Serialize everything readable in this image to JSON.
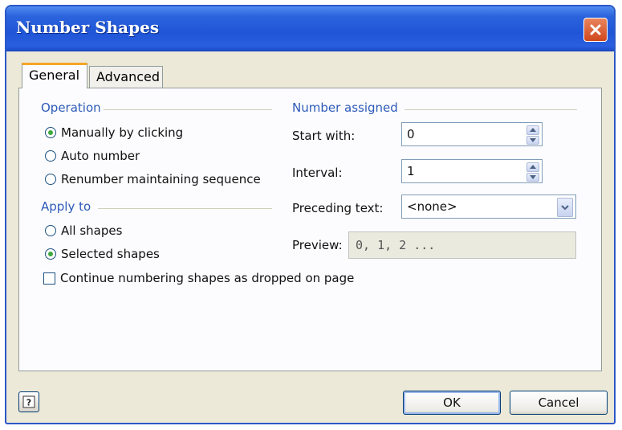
{
  "window": {
    "title": "Number Shapes",
    "accent_color": "#2b58c8",
    "close_icon": "close-icon"
  },
  "tabs": [
    {
      "label": "General",
      "selected": true
    },
    {
      "label": "Advanced",
      "selected": false
    }
  ],
  "operation": {
    "label": "Operation",
    "options": [
      {
        "label": "Manually by clicking",
        "selected": true
      },
      {
        "label": "Auto number",
        "selected": false
      },
      {
        "label": "Renumber maintaining sequence",
        "selected": false
      }
    ]
  },
  "apply_to": {
    "label": "Apply to",
    "options": [
      {
        "label": "All shapes",
        "selected": false
      },
      {
        "label": "Selected shapes",
        "selected": true
      }
    ]
  },
  "continue_numbering": {
    "label": "Continue numbering shapes as dropped on page",
    "checked": false
  },
  "number_assigned": {
    "label": "Number assigned",
    "start_with": {
      "label": "Start with:",
      "value": "0"
    },
    "interval": {
      "label": "Interval:",
      "value": "1"
    },
    "preceding_text": {
      "label": "Preceding text:",
      "value": "<none>"
    },
    "preview": {
      "label": "Preview:",
      "value": "0, 1, 2 ..."
    }
  },
  "footer": {
    "help_icon": "help-icon",
    "ok_label": "OK",
    "cancel_label": "Cancel"
  }
}
